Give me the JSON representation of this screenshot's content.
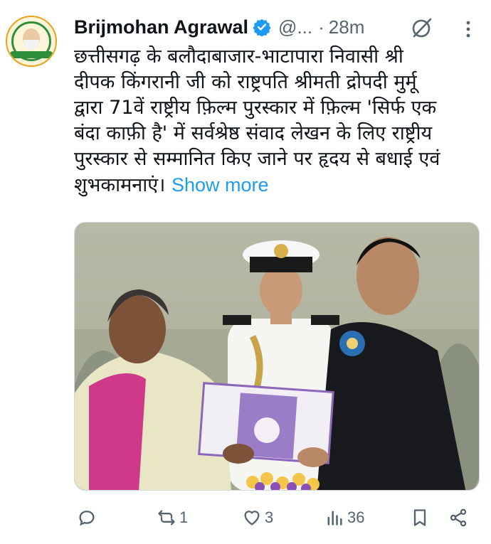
{
  "author": {
    "name": "Brijmohan Agrawal",
    "handle": "@...",
    "separator": "·",
    "time": "28m",
    "verified_color": "#1d9bf0"
  },
  "avatar_icon": "party-logo-avatar",
  "tweet": {
    "lines": [
      "छत्तीसगढ़ के बलौदाबाजार-भाटापारा निवासी श्री",
      "दीपक किंगरानी जी को राष्ट्रपति श्रीमती द्रोपदी मुर्मू",
      "द्वारा 71वें राष्ट्रीय फ़िल्म पुरस्कार में फ़िल्म 'सिर्फ एक",
      "बंदा काफ़ी है' में सर्वश्रेष्ठ संवाद लेखन के लिए राष्ट्रीय",
      "पुरस्कार से सम्मानित किए जाने पर हृदय से बधाई एवं"
    ],
    "last_line": "शुभकामनाएं।",
    "show_more": "Show more",
    "link_color": "#1d9bf0"
  },
  "media": {
    "icon": "award-ceremony-photo"
  },
  "actions": {
    "reply_count": "",
    "repost_count": "1",
    "like_count": "3",
    "views_count": "36",
    "muted_color": "#536471"
  }
}
